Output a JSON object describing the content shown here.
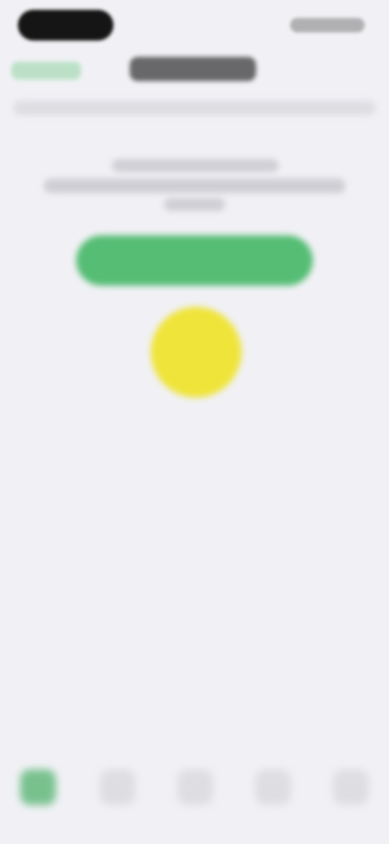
{
  "colors": {
    "background": "#f1f1f5",
    "accent_green": "#55bd74",
    "touch_yellow": "#efe43a",
    "text_dark": "#202020"
  },
  "status_bar": {
    "left_icon": "dynamic-island-icon",
    "right_icons": "status-icons"
  },
  "nav": {
    "back_label": "",
    "title": ""
  },
  "main": {
    "caption_lines": [
      "",
      "",
      ""
    ],
    "primary_button_label": ""
  },
  "tabbar": {
    "tabs": [
      {
        "icon": "home-icon"
      },
      {
        "icon": "tab-icon"
      },
      {
        "icon": "tab-icon"
      },
      {
        "icon": "tab-icon"
      },
      {
        "icon": "tab-icon"
      }
    ]
  }
}
